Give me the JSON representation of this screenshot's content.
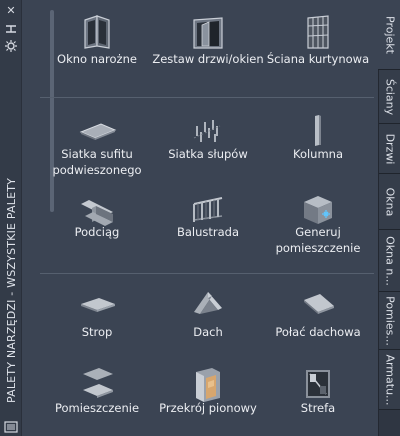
{
  "palette": {
    "title": "PALETY NARZĘDZI - WSZYSTKIE PALETY",
    "controls": [
      "close-icon",
      "autohide-icon",
      "properties-icon"
    ]
  },
  "sections": [
    {
      "tools": [
        {
          "label": "Okno narożne",
          "icon": "corner-window-icon"
        },
        {
          "label": "Zestaw drzwi/okien",
          "icon": "door-window-assembly-icon"
        },
        {
          "label": "Ściana kurtynowa",
          "icon": "curtain-wall-icon"
        }
      ]
    },
    {
      "tools": [
        {
          "label": "Siatka sufitu podwieszonego",
          "icon": "ceiling-grid-icon"
        },
        {
          "label": "Siatka słupów",
          "icon": "column-grid-icon"
        },
        {
          "label": "Kolumna",
          "icon": "column-icon"
        },
        {
          "label": "Podciąg",
          "icon": "beam-icon"
        },
        {
          "label": "Balustrada",
          "icon": "railing-icon"
        },
        {
          "label": "Generuj pomieszczenie",
          "icon": "generate-space-icon"
        }
      ]
    },
    {
      "tools": [
        {
          "label": "Strop",
          "icon": "slab-icon"
        },
        {
          "label": "Dach",
          "icon": "roof-icon"
        },
        {
          "label": "Połać dachowa",
          "icon": "roof-slab-icon"
        },
        {
          "label": "Pomieszczenie",
          "icon": "space-icon"
        },
        {
          "label": "Przekrój pionowy",
          "icon": "vertical-section-icon"
        },
        {
          "label": "Strefa",
          "icon": "zone-icon"
        }
      ]
    }
  ],
  "tabs": [
    {
      "label": "Projekt",
      "active": true
    },
    {
      "label": "Ściany",
      "active": false
    },
    {
      "label": "Drzwi",
      "active": false
    },
    {
      "label": "Okna",
      "active": false
    },
    {
      "label": "Okna n...",
      "active": false
    },
    {
      "label": "Pomies...",
      "active": false
    },
    {
      "label": "Armatu...",
      "active": false
    }
  ],
  "colors": {
    "background": "#3b4453",
    "text": "#eceef2",
    "divider": "#56606f"
  }
}
